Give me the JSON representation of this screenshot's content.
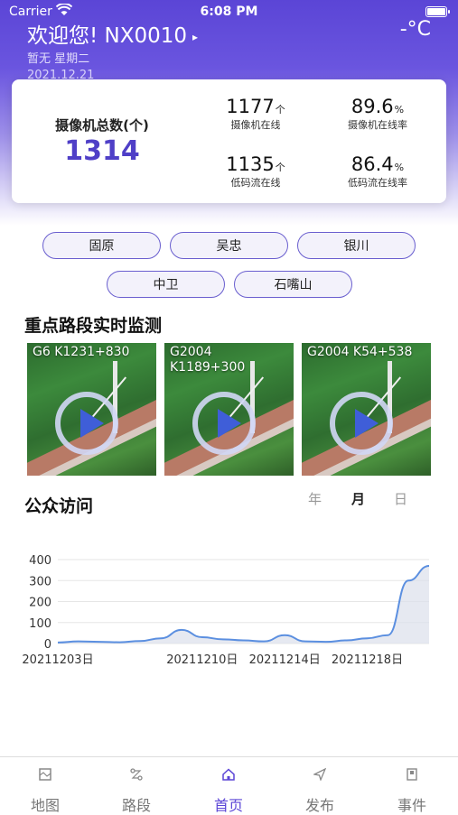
{
  "status_bar": {
    "carrier": "Carrier",
    "time": "6:08 PM"
  },
  "header": {
    "welcome": "欢迎您! NX0010",
    "temperature": "-°C",
    "weather": "暂无 星期二",
    "date": "2021.12.21"
  },
  "stats": {
    "total_label": "摄像机总数(个)",
    "total_value": "1314",
    "camera_online": {
      "value": "1177",
      "unit": "个",
      "label": "摄像机在线"
    },
    "camera_online_rate": {
      "value": "89.6",
      "unit": "%",
      "label": "摄像机在线率"
    },
    "lowbit_online": {
      "value": "1135",
      "unit": "个",
      "label": "低码流在线"
    },
    "lowbit_online_rate": {
      "value": "86.4",
      "unit": "%",
      "label": "低码流在线率"
    }
  },
  "regions": [
    "固原",
    "吴忠",
    "银川",
    "中卫",
    "石嘴山"
  ],
  "monitor": {
    "title": "重点路段实时监测",
    "videos": [
      "G6 K1231+830",
      "G2004 K1189+300",
      "G2004 K54+538"
    ]
  },
  "visits": {
    "title": "公众访问",
    "periods": [
      "年",
      "月",
      "日"
    ],
    "active_period": "月"
  },
  "chart_data": {
    "type": "area",
    "x": [
      "20211203",
      "20211204",
      "20211205",
      "20211206",
      "20211207",
      "20211208",
      "20211209",
      "20211210",
      "20211211",
      "20211212",
      "20211213",
      "20211214",
      "20211215",
      "20211216",
      "20211217",
      "20211218",
      "20211219",
      "20211220",
      "20211221"
    ],
    "values": [
      5,
      10,
      8,
      6,
      12,
      25,
      65,
      30,
      20,
      15,
      10,
      40,
      10,
      8,
      15,
      25,
      40,
      300,
      370
    ],
    "x_tick_labels": [
      "20211203日",
      "20211210日",
      "20211214日",
      "20211218日"
    ],
    "y_ticks": [
      0,
      100,
      200,
      300,
      400
    ],
    "ylim": [
      0,
      400
    ],
    "line_color": "#5b8fe0",
    "grid": true
  },
  "tabbar": {
    "items": [
      {
        "label": "地图",
        "icon": "map-icon"
      },
      {
        "label": "路段",
        "icon": "route-icon"
      },
      {
        "label": "首页",
        "icon": "home-icon"
      },
      {
        "label": "发布",
        "icon": "send-icon"
      },
      {
        "label": "事件",
        "icon": "event-icon"
      }
    ],
    "active_index": 2
  },
  "colors": {
    "brand": "#5b45d6",
    "accent": "#4f3fc7"
  }
}
